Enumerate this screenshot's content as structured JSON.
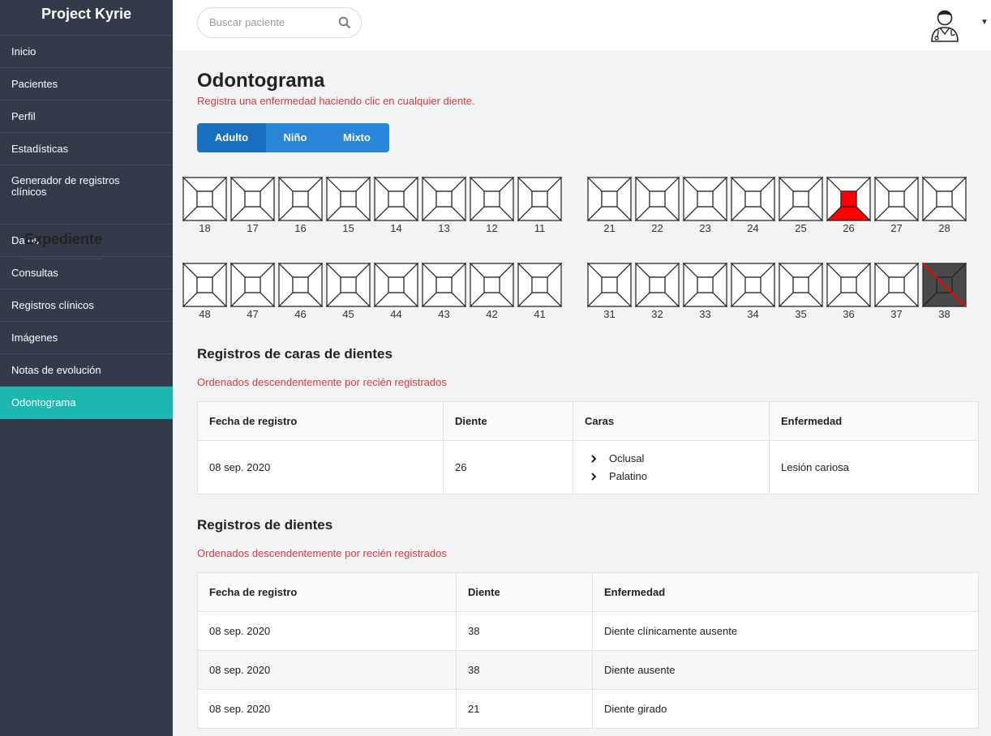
{
  "sidebar": {
    "brand": "Project Kyrie",
    "items": [
      {
        "label": "Inicio"
      },
      {
        "label": "Pacientes"
      },
      {
        "label": "Perfil"
      },
      {
        "label": "Estadísticas"
      },
      {
        "label": "Generador de registros clínicos"
      }
    ],
    "section_title": "Expediente",
    "expediente_items": [
      {
        "label": "Datos"
      },
      {
        "label": "Consultas"
      },
      {
        "label": "Registros clínicos"
      },
      {
        "label": "Imágenes"
      },
      {
        "label": "Notas de evolución"
      },
      {
        "label": "Odontograma"
      }
    ]
  },
  "topbar": {
    "search_placeholder": "Buscar paciente",
    "search_icon": "search-icon",
    "avatar_icon": "doctor-avatar-icon",
    "dropdown_icon": "caret-down-icon"
  },
  "main": {
    "title": "Odontograma",
    "subtitle": "Registra una enfermedad haciendo clic en cualquier diente.",
    "tabs": [
      {
        "label": "Adulto",
        "active": true
      },
      {
        "label": "Niño",
        "active": false
      },
      {
        "label": "Mixto",
        "active": false
      }
    ],
    "teeth": {
      "upper_right": [
        "18",
        "17",
        "16",
        "15",
        "14",
        "13",
        "12",
        "11"
      ],
      "upper_left": [
        "21",
        "22",
        "23",
        "24",
        "25",
        "26",
        "27",
        "28"
      ],
      "lower_right": [
        "48",
        "47",
        "46",
        "45",
        "44",
        "43",
        "42",
        "41"
      ],
      "lower_left": [
        "31",
        "32",
        "33",
        "34",
        "35",
        "36",
        "37",
        "38"
      ],
      "highlight_color": "#ff0000",
      "missing_fill": "#4a4a4a",
      "marked": {
        "26": [
          "Oclusal",
          "Palatino"
        ]
      },
      "missing": [
        "38"
      ]
    },
    "faces_section": {
      "title": "Registros de caras de dientes",
      "subtitle": "Ordenados descendentemente por recién registrados",
      "headers": [
        "Fecha de registro",
        "Diente",
        "Caras",
        "Enfermedad"
      ],
      "rows": [
        {
          "fecha": "08 sep. 2020",
          "diente": "26",
          "caras": [
            "Oclusal",
            "Palatino"
          ],
          "enfermedad": "Lesión cariosa"
        }
      ]
    },
    "teeth_section": {
      "title": "Registros de dientes",
      "subtitle": "Ordenados descendentemente por recién registrados",
      "headers": [
        "Fecha de registro",
        "Diente",
        "Enfermedad"
      ],
      "rows": [
        {
          "fecha": "08 sep. 2020",
          "diente": "38",
          "enfermedad": "Diente clínicamente ausente"
        },
        {
          "fecha": "08 sep. 2020",
          "diente": "38",
          "enfermedad": "Diente ausente"
        },
        {
          "fecha": "08 sep. 2020",
          "diente": "21",
          "enfermedad": "Diente girado"
        }
      ]
    }
  }
}
